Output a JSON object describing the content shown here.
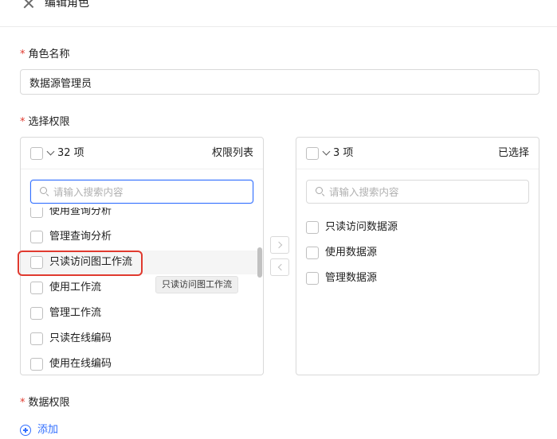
{
  "header": {
    "title": "编辑角色"
  },
  "role_name": {
    "label": "角色名称",
    "value": "数据源管理员"
  },
  "permissions": {
    "label": "选择权限",
    "left": {
      "count": "32 项",
      "title": "权限列表",
      "search_placeholder": "请输入搜索内容",
      "items": [
        {
          "label": "使用查询分析"
        },
        {
          "label": "管理查询分析"
        },
        {
          "label": "只读访问图工作流"
        },
        {
          "label": "使用工作流"
        },
        {
          "label": "管理工作流"
        },
        {
          "label": "只读在线编码"
        },
        {
          "label": "使用在线编码"
        }
      ]
    },
    "right": {
      "count": "3 项",
      "title": "已选择",
      "search_placeholder": "请输入搜索内容",
      "items": [
        {
          "label": "只读访问数据源"
        },
        {
          "label": "使用数据源"
        },
        {
          "label": "管理数据源"
        }
      ]
    },
    "tooltip": "只读访问图工作流"
  },
  "data_permission": {
    "label": "数据权限",
    "add_label": "添加"
  },
  "colors": {
    "accent": "#3370ff",
    "required": "#e03a2f",
    "highlight": "#e03a2f"
  }
}
